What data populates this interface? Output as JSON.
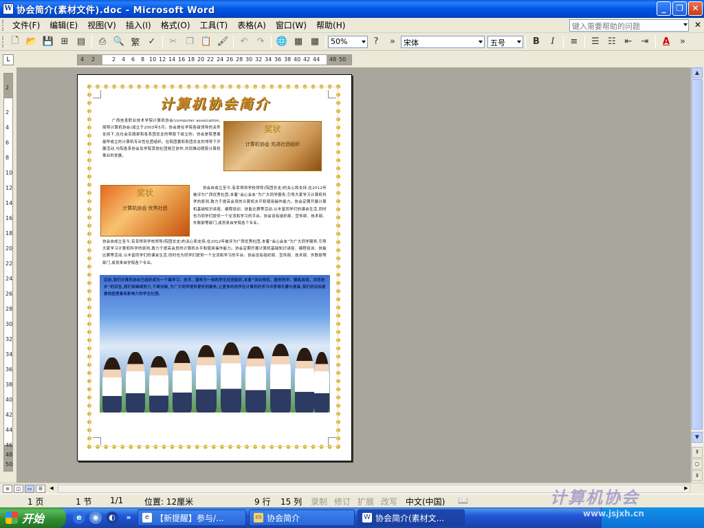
{
  "window": {
    "title": "协会简介(素材文件).doc - Microsoft Word"
  },
  "menu": {
    "items": [
      "文件(F)",
      "编辑(E)",
      "视图(V)",
      "插入(I)",
      "格式(O)",
      "工具(T)",
      "表格(A)",
      "窗口(W)",
      "帮助(H)"
    ],
    "help_placeholder": "键入需要帮助的问题"
  },
  "toolbar": {
    "zoom": "50%",
    "font": "宋体",
    "font_size": "五号"
  },
  "ruler": {
    "h_ticks": [
      "4",
      "2",
      "2",
      "4",
      "6",
      "8",
      "10",
      "12",
      "14",
      "16",
      "18",
      "20",
      "22",
      "24",
      "26",
      "28",
      "30",
      "32",
      "34",
      "36",
      "38",
      "40",
      "42",
      "44",
      "48",
      "50"
    ],
    "v_ticks": [
      "2",
      "2",
      "4",
      "6",
      "8",
      "10",
      "12",
      "14",
      "16",
      "18",
      "20",
      "22",
      "24",
      "26",
      "28",
      "30",
      "32",
      "34",
      "36",
      "38",
      "40",
      "42",
      "44",
      "46",
      "48",
      "50"
    ]
  },
  "document": {
    "title": "计算机协会简介",
    "para1": "广西信息职业技术学院计算机协会(computer association,简称计算机协会)成立于2003年5月。协会是在学院各级领导的关怀支持下,在社会实践部和各系团总支的帮助下成立的。协会是院里面最早成立的计算机专业性社团组织。在院团委和系团总支的领导下开展活动,与院各系协会及学院其他社团相互协作,共同推动我院计算机事业的发展。",
    "para2": "协会自成立至今,有幸得到学校领导(院团总支)的关心和支持,在2012年被评为广西优秀社团,本着“会心会友”为广大同学服务,引导大家学习计算机科学的原则,致力于提高会员的计算机水平和使用操作能力。协会定期开展计算机基础知识讲座、编程培训、技能比赛等活动,以丰富同学们的课余生活,同时也为同学们提供一个交流和学习的平台。协会设有组织部、宣传部、技术部、外联部等部门,成员来自学院各个专业。",
    "para3": "目前,我们计算机协会已组织成为一个集学习、技术、服务为一体的学生社团组织,本着“突出特色、服务同学、锻炼自我、共同进步”的宗旨,我们将继续努力,不断创新,为广大同学提供更好的服务,让更多的同学在计算机的学习中获得乐趣与提高,我们的目标是做校园里最有影响力的学生社团。",
    "award1_title": "奖状",
    "award1_text": "计算机协会 先进社团组织",
    "award2_title": "奖状",
    "award2_text": "计算机协会 优秀社团"
  },
  "status": {
    "page": "1 页",
    "section": "1 节",
    "page_of": "1/1",
    "position": "位置: 12厘米",
    "line": "9 行",
    "column": "15 列",
    "rec": "录制",
    "trk": "修订",
    "ext": "扩展",
    "ovr": "改写",
    "lang": "中文(中国)"
  },
  "taskbar": {
    "start": "开始",
    "tasks": [
      "【新提醒】参与/...",
      "协会简介",
      "协会简介(素材文..."
    ]
  },
  "watermark": {
    "text": "计算机协会",
    "url": "www.jsjxh.cn"
  },
  "colors": {
    "titlebar": "#0055e5",
    "doc_bg": "#a9a79d",
    "border_stars": "#d8b43a",
    "title_gold": "#c88a2a"
  }
}
